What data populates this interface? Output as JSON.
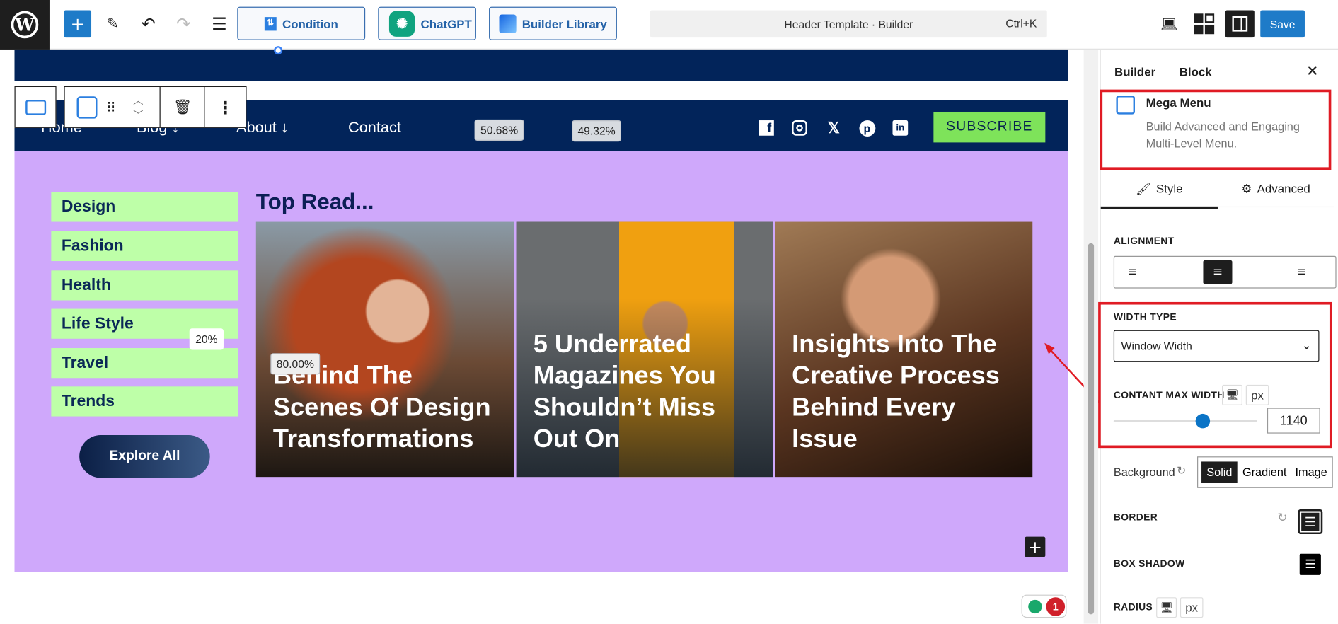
{
  "toolbar": {
    "condition": "Condition",
    "chatgpt": "ChatGPT",
    "builder_library": "Builder Library",
    "search_title": "Header Template · Builder",
    "shortcut": "Ctrl+K",
    "save": "Save"
  },
  "nav": {
    "items": [
      "Home",
      "Blog ↓",
      "About ↓",
      "Contact"
    ],
    "subscribe": "SUBSCRIBE",
    "col_widths": [
      "50.68%",
      "49.32%"
    ],
    "social": [
      "facebook",
      "instagram",
      "x",
      "pinterest",
      "linkedin"
    ]
  },
  "mega": {
    "categories": [
      "Design",
      "Fashion",
      "Health",
      "Life Style",
      "Travel",
      "Trends"
    ],
    "explore": "Explore All",
    "heading": "Top Read...",
    "col_left_pct": "20%",
    "col_right_pct": "80.00%",
    "cards": [
      "Behind The Scenes Of Design Transformations",
      "5 Underrated Magazines You Shouldn’t Miss Out On",
      "Insights Into The Creative Process Behind Every Issue"
    ]
  },
  "notifications": "1",
  "panel": {
    "tabs": [
      "Builder",
      "Block"
    ],
    "block_name": "Mega Menu",
    "block_desc": "Build Advanced and Engaging Multi-Level Menu.",
    "style_tab": "Style",
    "advanced_tab": "Advanced",
    "alignment_label": "ALIGNMENT",
    "alignment_selected": "center",
    "width_type_label": "WIDTH TYPE",
    "width_type": "Window Width",
    "max_width_label": "CONTANT MAX WIDTH",
    "unit": "px",
    "max_width": "1140",
    "slider_fraction": 0.62,
    "background_label": "Background",
    "bg_options": [
      "Solid",
      "Gradient",
      "Image"
    ],
    "bg_selected": "Solid",
    "border_label": "BORDER",
    "shadow_label": "BOX SHADOW",
    "radius_label": "RADIUS"
  },
  "colors": {
    "accent": "#1e7bc8",
    "navy": "#02245a",
    "purple": "#cfa8fb",
    "category_bg": "#beffa8",
    "subscribe": "#7ee35a",
    "highlight": "#e01b24"
  }
}
